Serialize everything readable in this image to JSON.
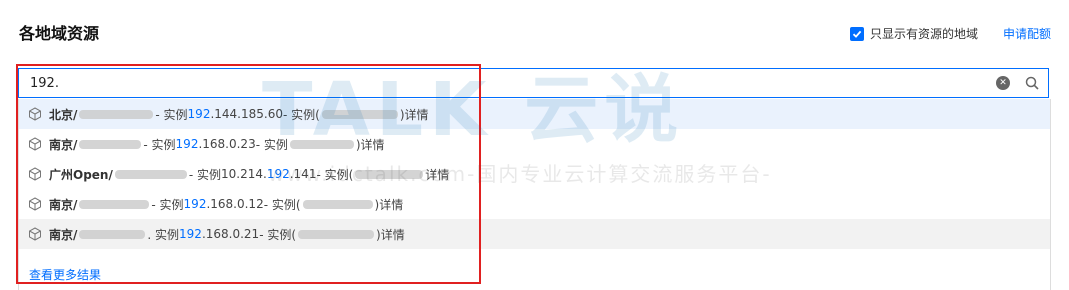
{
  "header": {
    "title": "各地域资源",
    "filter_label": "只显示有资源的地域",
    "filter_checked": true,
    "apply_link": "申请配额"
  },
  "search": {
    "value": "192.",
    "query": "192"
  },
  "results": [
    {
      "region": "北京/",
      "sep": " - 实例",
      "ip_pre": "",
      "ip_match": "192",
      "ip_post": ".144.185.60",
      "sep2": " - 实例(",
      "tail": ")详情",
      "highlight": true
    },
    {
      "region": "南京/",
      "sep": " - 实例",
      "ip_pre": "",
      "ip_match": "192",
      "ip_post": ".168.0.23",
      "sep2": " - 实例",
      "tail": ")详情",
      "highlight": false
    },
    {
      "region": "广州Open/",
      "sep": " - 实例",
      "ip_pre": "10.214.",
      "ip_match": "192",
      "ip_post": ".141",
      "sep2": " - 实例(",
      "tail": "详情",
      "highlight": false
    },
    {
      "region": "南京/",
      "sep": " - 实例",
      "ip_pre": "",
      "ip_match": "192",
      "ip_post": ".168.0.12",
      "sep2": " - 实例(",
      "tail": ")详情",
      "highlight": false
    },
    {
      "region": "南京/",
      "sep": ". 实例",
      "ip_pre": "",
      "ip_match": "192",
      "ip_post": ".168.0.21",
      "sep2": " - 实例(",
      "tail": ")详情",
      "highlight": false
    }
  ],
  "more_link": "查看更多结果",
  "watermark": {
    "logo": "TALK 云说",
    "text": "www.idctalk.com-国内专业云计算交流服务平台-"
  },
  "colors": {
    "accent": "#006eff",
    "annotation_box": "#e02020",
    "row_highlight": "#eaf2fd"
  },
  "icons": {
    "filter_checkbox": "check-icon",
    "clear": "close-circle-icon",
    "search": "search-icon",
    "result": "cube-icon"
  }
}
